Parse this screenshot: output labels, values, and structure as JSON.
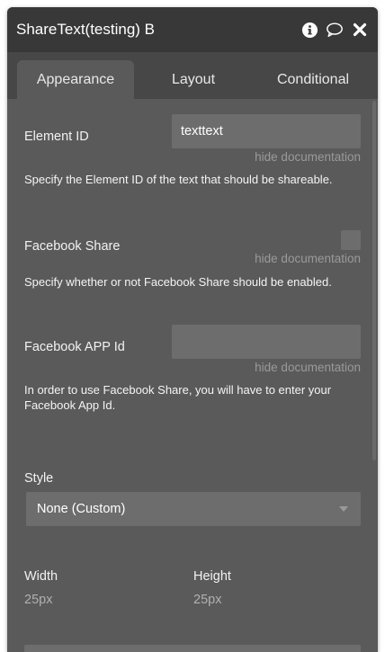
{
  "window": {
    "title": "ShareText(testing) B"
  },
  "titlebar_icons": [
    "info-icon",
    "comment-icon",
    "close-icon"
  ],
  "tabs": [
    {
      "label": "Appearance",
      "active": true
    },
    {
      "label": "Layout",
      "active": false
    },
    {
      "label": "Conditional",
      "active": false
    }
  ],
  "fields": {
    "element_id": {
      "label": "Element ID",
      "value": "texttext",
      "hide_doc": "hide documentation",
      "doc": "Specify the Element ID of the text that should be shareable."
    },
    "facebook_share": {
      "label": "Facebook Share",
      "checked": false,
      "hide_doc": "hide documentation",
      "doc": "Specify whether or not Facebook Share should be enabled."
    },
    "facebook_app_id": {
      "label": "Facebook APP Id",
      "value": "",
      "hide_doc": "hide documentation",
      "doc": "In order to use Facebook Share, you will have to enter your Facebook App Id."
    }
  },
  "style": {
    "label": "Style",
    "selected": "None (Custom)"
  },
  "dimensions": {
    "width_label": "Width",
    "width_value": "25px",
    "height_label": "Height",
    "height_value": "25px"
  },
  "colors": {
    "header": "#383838",
    "tabs_bg": "#474747",
    "panel": "#5a5a5a",
    "input": "#6d6d6d",
    "muted": "#9a9a9a"
  }
}
